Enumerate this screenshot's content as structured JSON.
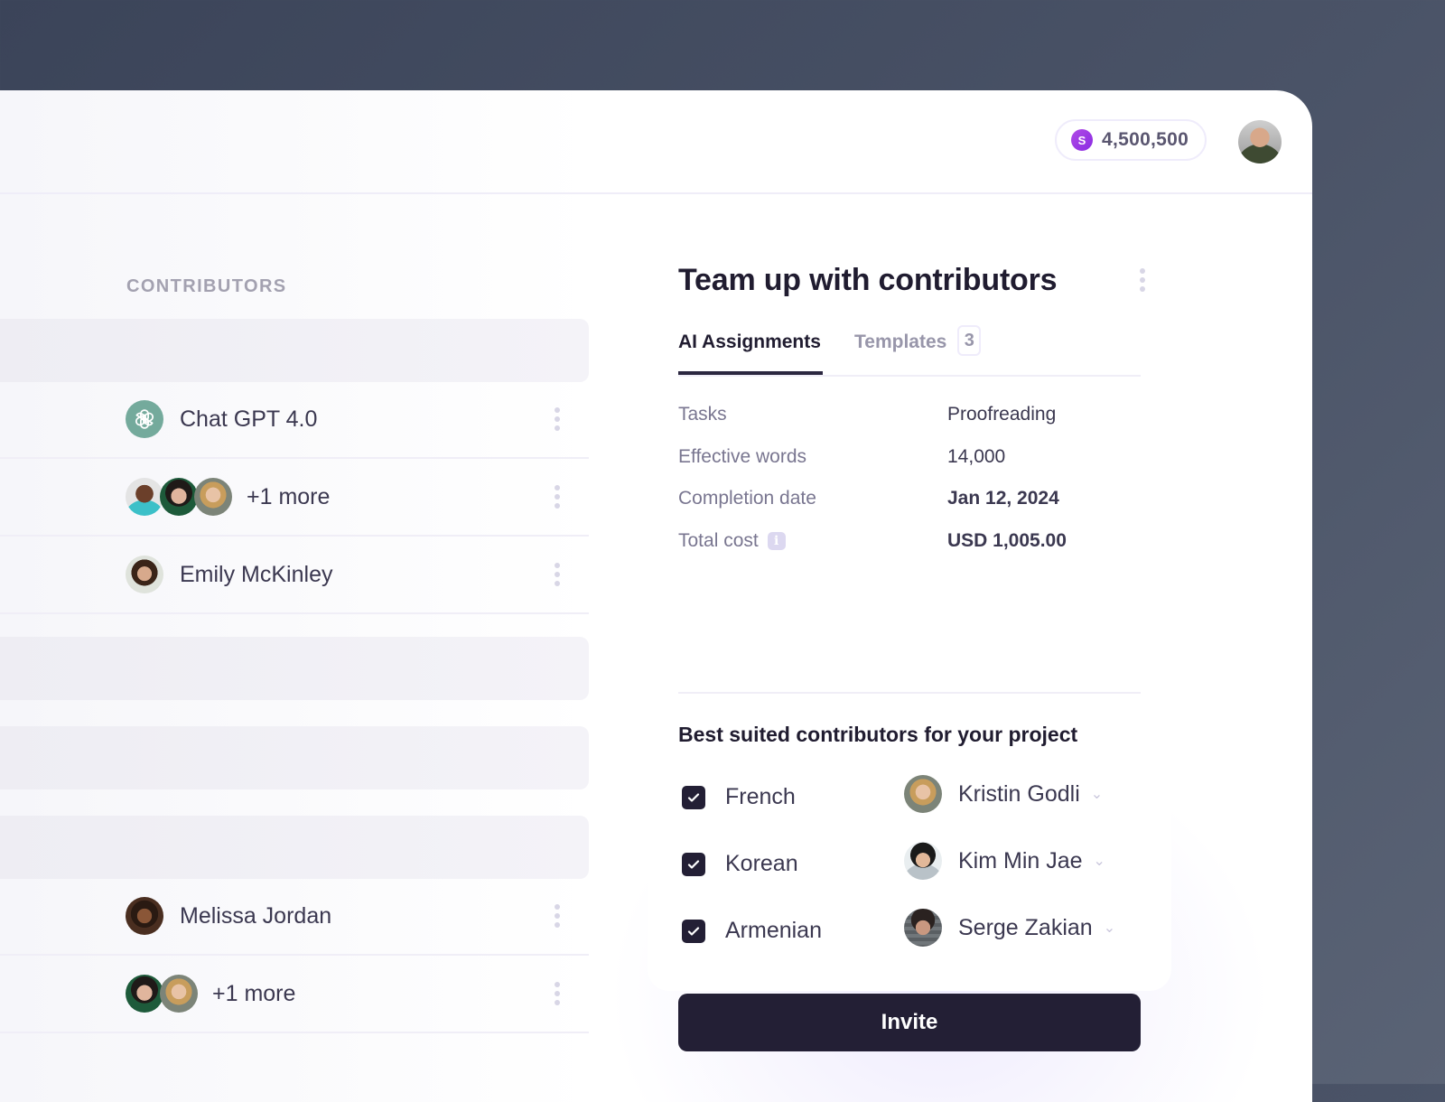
{
  "header": {
    "credits": {
      "icon": "S",
      "amount": "4,500,500",
      "color": "#9b3fe0"
    },
    "user_avatar": "user-avatar"
  },
  "contributors": {
    "section_label": "CONTRIBUTORS",
    "rows": [
      {
        "type": "ai",
        "name": "Chat GPT 4.0"
      },
      {
        "type": "group",
        "name": "+1 more",
        "avatar_count": 3
      },
      {
        "type": "person",
        "name": "Emily McKinley"
      },
      {
        "type": "person",
        "name": "Melissa Jordan"
      },
      {
        "type": "group",
        "name": "+1 more",
        "avatar_count": 2
      }
    ]
  },
  "card": {
    "title": "Team up with contributors",
    "tabs": [
      {
        "label": "AI Assignments",
        "active": true
      },
      {
        "label": "Templates",
        "badge": "3",
        "active": false
      }
    ],
    "details": [
      {
        "label": "Tasks",
        "value": "Proofreading"
      },
      {
        "label": "Effective words",
        "value": "14,000"
      },
      {
        "label": "Completion date",
        "value": "Jan 12, 2024"
      },
      {
        "label": "Total cost",
        "value": "USD 1,005.00",
        "info": true
      }
    ],
    "best_title": "Best suited contributors for your project",
    "languages": [
      {
        "language": "French",
        "checked": true,
        "assignee": "Kristin Godli"
      },
      {
        "language": "Korean",
        "checked": true,
        "assignee": "Kim Min Jae"
      },
      {
        "language": "Armenian",
        "checked": true,
        "assignee": "Serge Zakian"
      }
    ],
    "invite_label": "Invite"
  }
}
